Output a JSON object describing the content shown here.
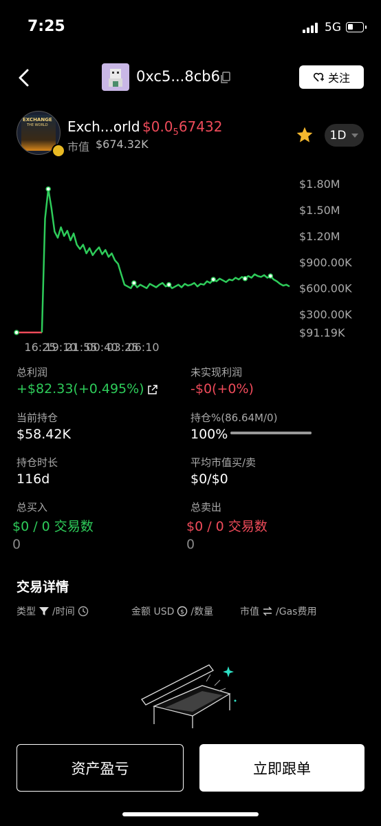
{
  "status_bar": {
    "time": "7:25",
    "network": "5G"
  },
  "header": {
    "address": "0xc5...8cb6",
    "follow_label": "关注"
  },
  "token": {
    "name": "Exch...orld",
    "price_prefix": "$0.0",
    "price_zeros": "5",
    "price_digits": "67432",
    "logo_text_1": "EXCHANGE",
    "logo_text_2": "THE WORLD",
    "mcap_label": "市值",
    "mcap_value": "$674.32K",
    "period": "1D"
  },
  "colors": {
    "up": "#2ecc5a",
    "down": "#ef4b5a",
    "star": "#f5b82e"
  },
  "chart_data": {
    "type": "line",
    "y_ticks": [
      "$1.80M",
      "$1.50M",
      "$1.20M",
      "$900.00K",
      "$600.00K",
      "$300.00K",
      "$91.19K"
    ],
    "x_ticks": [
      "16:25",
      "19:10",
      "21:55",
      "00:40",
      "03:25",
      "06:10"
    ],
    "x_minutes": [
      0,
      10,
      20,
      25,
      30,
      35,
      40,
      45,
      50,
      55,
      60,
      70,
      80,
      90,
      100,
      110,
      120,
      130,
      140,
      150,
      160,
      170,
      180,
      190,
      200,
      210,
      220,
      230,
      240,
      250,
      260,
      270,
      280,
      290,
      300,
      310,
      320,
      330,
      340,
      350,
      360,
      370,
      380,
      390,
      400,
      410,
      420,
      430,
      440,
      450,
      460,
      470,
      480,
      490,
      500,
      510,
      520,
      530,
      540,
      550,
      560,
      570,
      580,
      590,
      600,
      610,
      620,
      630,
      640,
      650,
      660,
      670,
      680,
      690,
      700,
      710,
      720,
      730,
      740,
      750,
      760,
      770,
      780,
      790,
      800,
      810,
      820,
      830,
      840,
      850,
      860
    ],
    "market_cap_usd": [
      91190,
      91190,
      91190,
      91190,
      91190,
      91190,
      91190,
      91190,
      91190,
      91190,
      91190,
      91190,
      91190,
      1400000,
      1740000,
      1520000,
      1250000,
      1180000,
      1300000,
      1200000,
      1260000,
      1150000,
      1230000,
      1100000,
      1050000,
      1100000,
      1000000,
      1060000,
      980000,
      1030000,
      1070000,
      990000,
      1040000,
      960000,
      1000000,
      920000,
      880000,
      760000,
      640000,
      620000,
      600000,
      660000,
      610000,
      640000,
      620000,
      600000,
      650000,
      630000,
      610000,
      640000,
      660000,
      620000,
      640000,
      600000,
      620000,
      640000,
      610000,
      650000,
      630000,
      640000,
      660000,
      620000,
      650000,
      640000,
      680000,
      660000,
      700000,
      680000,
      710000,
      690000,
      670000,
      700000,
      690000,
      720000,
      700000,
      730000,
      710000,
      740000,
      720000,
      760000,
      740000,
      730000,
      750000,
      720000,
      740000,
      700000,
      680000,
      650000,
      630000,
      640000,
      620000
    ],
    "trade_markers_minutes": [
      0,
      100,
      370,
      480,
      620,
      720,
      800
    ]
  },
  "stats": {
    "total_profit_label": "总利润",
    "total_profit_value": "+$82.33(+0.495%)",
    "unrealized_label": "未实现利润",
    "unrealized_value": "-$0(+0%)",
    "holding_label": "当前持仓",
    "holding_value": "$58.42K",
    "position_pct_label": "持仓%(86.64M/0)",
    "position_pct_value": "100%",
    "position_pct_fraction": 1.0,
    "duration_label": "持仓时长",
    "duration_value": "116d",
    "avg_mcap_label": "平均市值买/卖",
    "avg_mcap_value": "$0/$0",
    "total_buy_label": "总买入",
    "total_buy_value": "$0 / 0 交易数",
    "total_buy_sub": "0",
    "total_sell_label": "总卖出",
    "total_sell_value": "$0 / 0 交易数",
    "total_sell_sub": "0"
  },
  "trades": {
    "title": "交易详情",
    "col_type": "类型",
    "col_time": "/时间",
    "col_amount": "金额 USD",
    "col_qty": "/数量",
    "col_mcap": "市值",
    "col_gas": "/Gas费用"
  },
  "buttons": {
    "pnl": "资产盈亏",
    "copy_trade": "立即跟单"
  }
}
